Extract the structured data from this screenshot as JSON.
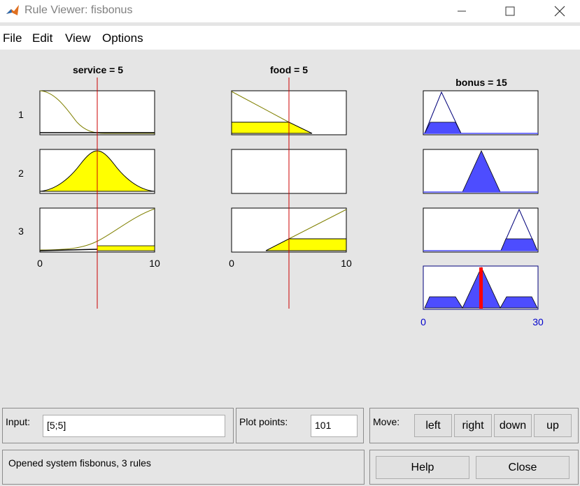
{
  "window": {
    "title": "Rule Viewer: fisbonus",
    "controls": [
      "minimize-icon",
      "maximize-icon",
      "close-icon"
    ]
  },
  "menu": {
    "items": [
      "File",
      "Edit",
      "View",
      "Options"
    ]
  },
  "plots": {
    "inputs": [
      {
        "title": "service = 5",
        "range_labels": [
          "0",
          "10"
        ]
      },
      {
        "title": "food = 5",
        "range_labels": [
          "0",
          "10"
        ]
      }
    ],
    "output": {
      "title": "bonus = 15",
      "range_labels": [
        "0",
        "30"
      ]
    },
    "rule_numbers": [
      "1",
      "2",
      "3"
    ],
    "colors": {
      "input_fill": "#ffff00",
      "output_fill": "#4d4dff",
      "index_line": "#cc0000",
      "result_bar": "#ff0000",
      "axis_blue": "#0000cc"
    },
    "input_value": 5,
    "output_value": 15
  },
  "input_panel": {
    "label": "Input:",
    "value": "[5;5]"
  },
  "plot_points_panel": {
    "label": "Plot points:",
    "value": "101"
  },
  "move_panel": {
    "label": "Move:",
    "buttons": [
      "left",
      "right",
      "down",
      "up"
    ]
  },
  "status": {
    "text": "Opened system fisbonus, 3 rules"
  },
  "actions": {
    "help": "Help",
    "close": "Close"
  }
}
